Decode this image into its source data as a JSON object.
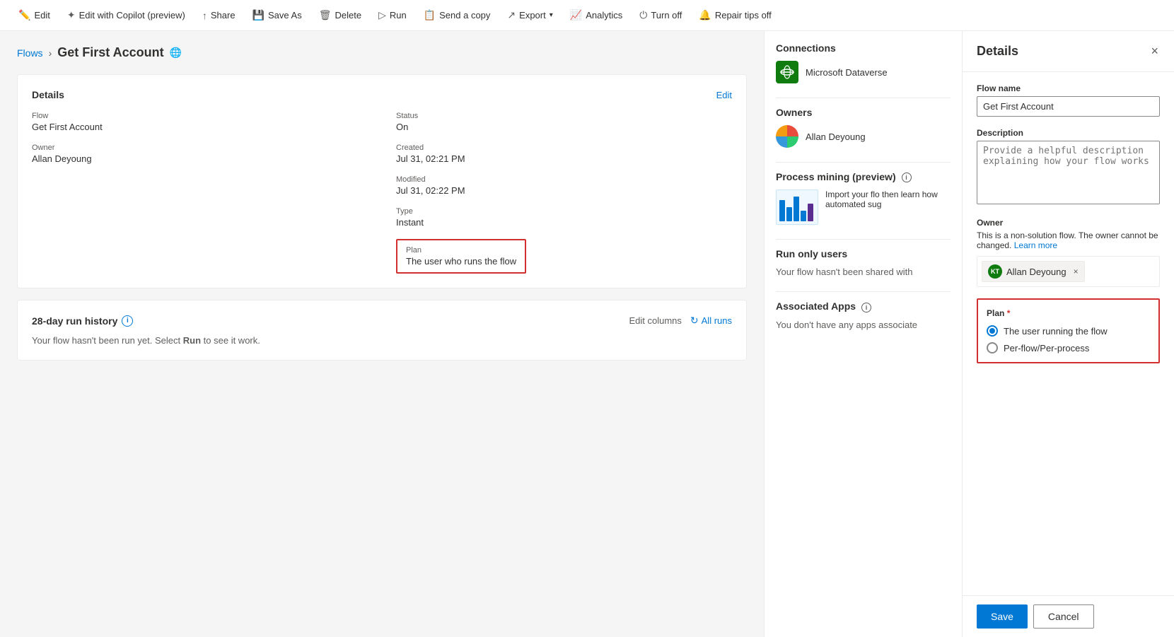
{
  "toolbar": {
    "edit_label": "Edit",
    "edit_copilot_label": "Edit with Copilot (preview)",
    "share_label": "Share",
    "save_as_label": "Save As",
    "delete_label": "Delete",
    "run_label": "Run",
    "send_copy_label": "Send a copy",
    "export_label": "Export",
    "analytics_label": "Analytics",
    "turn_off_label": "Turn off",
    "repair_tips_label": "Repair tips off"
  },
  "breadcrumb": {
    "flows": "Flows",
    "current": "Get First Account"
  },
  "details_card": {
    "title": "Details",
    "edit_label": "Edit",
    "flow_label": "Flow",
    "flow_value": "Get First Account",
    "owner_label": "Owner",
    "owner_value": "Allan Deyoung",
    "status_label": "Status",
    "status_value": "On",
    "created_label": "Created",
    "created_value": "Jul 31, 02:21 PM",
    "modified_label": "Modified",
    "modified_value": "Jul 31, 02:22 PM",
    "type_label": "Type",
    "type_value": "Instant",
    "plan_label": "Plan",
    "plan_value": "The user who runs the flow"
  },
  "run_history": {
    "title": "28-day run history",
    "edit_columns": "Edit columns",
    "all_runs": "All runs",
    "empty_message": "Your flow hasn't been run yet. Select",
    "empty_keyword": "Run",
    "empty_suffix": "to see it work."
  },
  "connections": {
    "title": "Connections",
    "items": [
      {
        "name": "Microsoft Dataverse",
        "icon": "🗄"
      }
    ]
  },
  "owners": {
    "title": "Owners",
    "name": "Allan Deyoung"
  },
  "process_mining": {
    "title": "Process mining (preview)",
    "description": "Import your flo then learn how automated sug"
  },
  "run_only_users": {
    "title": "Run only users",
    "message": "Your flow hasn't been shared with"
  },
  "associated_apps": {
    "title": "Associated Apps",
    "message": "You don't have any apps associate"
  },
  "details_panel": {
    "title": "Details",
    "close_label": "×",
    "flow_name_label": "Flow name",
    "flow_name_value": "Get First Account",
    "description_label": "Description",
    "description_placeholder": "Provide a helpful description explaining how your flow works",
    "owner_label": "Owner",
    "owner_note": "This is a non-solution flow. The owner cannot be changed.",
    "owner_learn_more": "Learn more",
    "owner_name": "Allan Deyoung",
    "owner_initials": "KT",
    "plan_label": "Plan",
    "plan_required": "*",
    "plan_options": [
      {
        "id": "user-running",
        "label": "The user running the flow",
        "selected": true
      },
      {
        "id": "per-flow",
        "label": "Per-flow/Per-process",
        "selected": false
      }
    ],
    "save_label": "Save",
    "cancel_label": "Cancel"
  }
}
